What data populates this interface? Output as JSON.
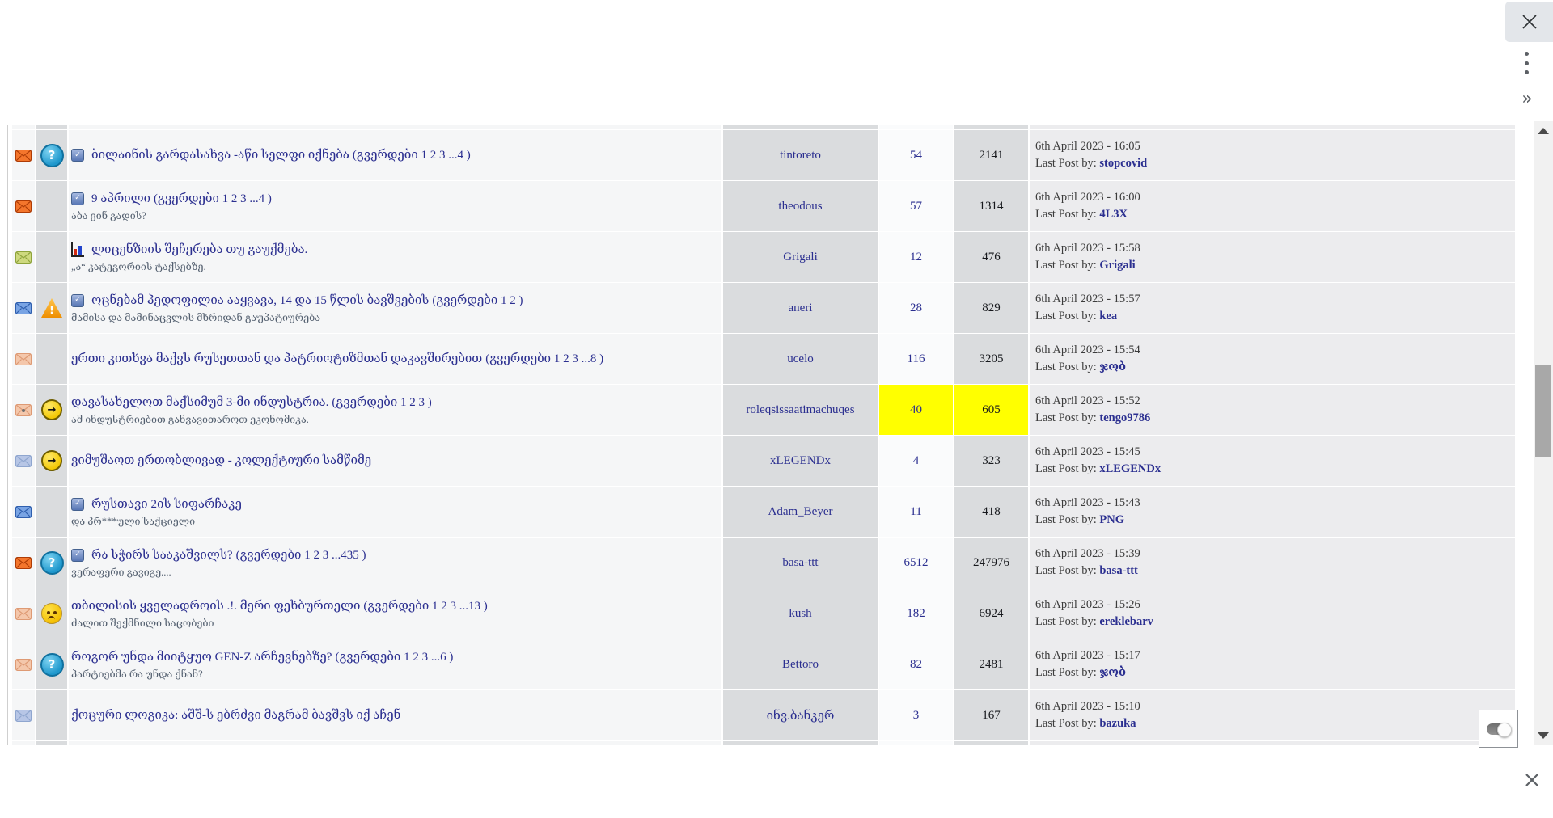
{
  "page": {
    "background": "#ffffff"
  },
  "top_controls": {
    "close": {
      "icon": "close-icon"
    },
    "menu": {
      "icon": "kebab-menu-icon"
    },
    "chevron_glyph": "»"
  },
  "bottom_controls": {
    "close": {
      "icon": "close-icon"
    },
    "toggle_state": "on"
  },
  "scrollbar": {
    "up_icon": "scroll-up-icon",
    "down_icon": "scroll-down-icon",
    "thumb": "scrollbar-thumb"
  },
  "colors": {
    "highlight": "#ffff00",
    "link_blue": "#2b2f90",
    "cell_grey": "#dadcde",
    "cell_light": "#f5f6f7"
  },
  "table": {
    "last_post_label": "Last Post by:",
    "rows": [
      {
        "envelope": "orange",
        "status": "question",
        "title_icon": "check",
        "title": "ბილაინის გარდასახვა -აწი სელფი იქნება",
        "pages": "(გვერდები 1 2 3 ...4 )",
        "desc": "",
        "author": "tintoreto",
        "replies": "54",
        "views": "2141",
        "date": "6th April 2023 - 16:05",
        "last_by": "stopcovid",
        "highlight": false,
        "wrap": false
      },
      {
        "envelope": "orange",
        "status": "",
        "title_icon": "check",
        "title": "9 აპრილი",
        "pages": "(გვერდები 1 2 3 ...4 )",
        "desc": "აბა ვინ გადის?",
        "author": "theodous",
        "replies": "57",
        "views": "1314",
        "date": "6th April 2023 - 16:00",
        "last_by": "4L3X",
        "highlight": false,
        "wrap": false
      },
      {
        "envelope": "green",
        "status": "",
        "title_icon": "poll",
        "title": "ლიცენზიის შეჩერება თუ გაუქმება.",
        "pages": "",
        "desc": "„ა“ კატეგორიის ტაქსებზე.",
        "author": "Grigali",
        "replies": "12",
        "views": "476",
        "date": "6th April 2023 - 15:58",
        "last_by": "Grigali",
        "highlight": false,
        "wrap": false
      },
      {
        "envelope": "blue",
        "status": "warning",
        "title_icon": "check",
        "title": "ოცნებამ პედოფილია ააყვავა, 14 და 15 წლის ბავშვების",
        "pages": "(გვერდები 1 2 )",
        "desc": "მამისა და მამინაცვლის მხრიდან გაუპატიურება",
        "author": "aneri",
        "replies": "28",
        "views": "829",
        "date": "6th April 2023 - 15:57",
        "last_by": "kea",
        "highlight": false,
        "wrap": false
      },
      {
        "envelope": "pale",
        "status": "",
        "title_icon": "",
        "title": "ერთი კითხვა მაქვს რუსეთთან და პატრიოტიზმთან დაკავშირებით",
        "pages": "(გვერდები 1 2 3 ...8 )",
        "desc": "",
        "author": "ucelo",
        "replies": "116",
        "views": "3205",
        "date": "6th April 2023 - 15:54",
        "last_by": "ჯობ",
        "highlight": false,
        "wrap": true
      },
      {
        "envelope": "pale-dot",
        "status": "moved",
        "title_icon": "",
        "title": "დავასახელოთ მაქსიმუმ 3-მი ინდუსტრია.",
        "pages": "(გვერდები 1 2 3 )",
        "desc": "ამ ინდუსტრიებით განვავითაროთ ეკონომიკა.",
        "author": "roleqsissaatimachuqes",
        "replies": "40",
        "views": "605",
        "date": "6th April 2023 - 15:52",
        "last_by": "tengo9786",
        "highlight": true,
        "wrap": false
      },
      {
        "envelope": "lightblue",
        "status": "moved",
        "title_icon": "",
        "title": "ვიმუშაოთ ერთობლივად - კოლექტიური სამწიმე",
        "pages": "",
        "desc": "",
        "author": "xLEGENDx",
        "replies": "4",
        "views": "323",
        "date": "6th April 2023 - 15:45",
        "last_by": "xLEGENDx",
        "highlight": false,
        "wrap": false
      },
      {
        "envelope": "blue",
        "status": "",
        "title_icon": "check",
        "title": "რუსთავი 2ის სიფარჩაკე",
        "pages": "",
        "desc": "და პრ***ული საქციელი",
        "author": "Adam_Beyer",
        "replies": "11",
        "views": "418",
        "date": "6th April 2023 - 15:43",
        "last_by": "PNG",
        "highlight": false,
        "wrap": false
      },
      {
        "envelope": "orange",
        "status": "question",
        "title_icon": "check",
        "title": "რა სჭირს სააკაშვილს?",
        "pages": "(გვერდები 1 2 3 ...435 )",
        "desc": "ვერაფერი გავიგე....",
        "author": "basa-ttt",
        "replies": "6512",
        "views": "247976",
        "date": "6th April 2023 - 15:39",
        "last_by": "basa-ttt",
        "highlight": false,
        "wrap": false
      },
      {
        "envelope": "pale",
        "status": "angry",
        "title_icon": "",
        "title": "თბილისის ყველადროის .!. მერი ფეხბურთელი",
        "pages": "(გვერდები 1 2 3 ...13 )",
        "desc": "ძალით შექმნილი საცობები",
        "author": "kush",
        "replies": "182",
        "views": "6924",
        "date": "6th April 2023 - 15:26",
        "last_by": "ereklebarv",
        "highlight": false,
        "wrap": false
      },
      {
        "envelope": "pale",
        "status": "question",
        "title_icon": "",
        "title": "როგორ უნდა მიიტყუო GEN-Z არჩევნებზე?",
        "pages": "(გვერდები 1 2 3 ...6 )",
        "desc": "პარტიებმა რა უნდა ქნან?",
        "author": "Bettoro",
        "replies": "82",
        "views": "2481",
        "date": "6th April 2023 - 15:17",
        "last_by": "ჯობ",
        "highlight": false,
        "wrap": false
      },
      {
        "envelope": "lightblue",
        "status": "",
        "title_icon": "",
        "title": "ქოცური ლოგიკა: აშშ-ს ებრძვი მაგრამ ბავშვს იქ აჩენ",
        "pages": "",
        "desc": "",
        "author": "ინვ.ბანკერ",
        "replies": "3",
        "views": "167",
        "date": "6th April 2023 - 15:10",
        "last_by": "bazuka",
        "highlight": false,
        "wrap": false
      }
    ]
  }
}
